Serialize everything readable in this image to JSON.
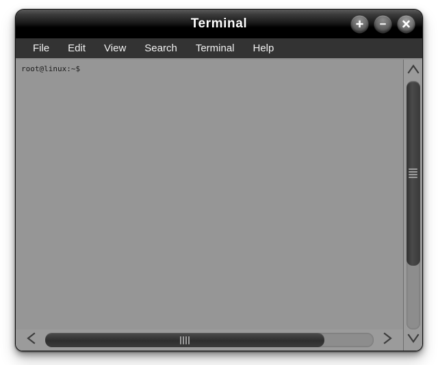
{
  "window": {
    "title": "Terminal",
    "controls": [
      {
        "name": "maximize-button",
        "icon": "plus-icon",
        "label": "+"
      },
      {
        "name": "minimize-button",
        "icon": "minus-icon",
        "label": "−"
      },
      {
        "name": "close-button",
        "icon": "close-icon",
        "label": "×"
      }
    ]
  },
  "menubar": {
    "items": [
      {
        "label": "File"
      },
      {
        "label": "Edit"
      },
      {
        "label": "View"
      },
      {
        "label": "Search"
      },
      {
        "label": "Terminal"
      },
      {
        "label": "Help"
      }
    ]
  },
  "terminal": {
    "prompt": "root@linux:~$",
    "lines": [
      "root@linux:~$"
    ]
  },
  "scrollbars": {
    "vertical": {
      "up_icon": "chevron-up-icon",
      "down_icon": "chevron-down-icon",
      "grip_icon": "grip-horizontal-icon"
    },
    "horizontal": {
      "left_icon": "chevron-left-icon",
      "right_icon": "chevron-right-icon",
      "grip_icon": "grip-vertical-icon"
    }
  },
  "colors": {
    "titlebar_top": "#5a5a5a",
    "titlebar_bottom": "#000000",
    "menubar_bg": "#333333",
    "terminal_bg": "#969696",
    "terminal_fg": "#1c1c1c",
    "scrollbar_track": "#8d8d8d",
    "scrollbar_thumb": "#333333",
    "desktop_bg": "#ffffff"
  }
}
